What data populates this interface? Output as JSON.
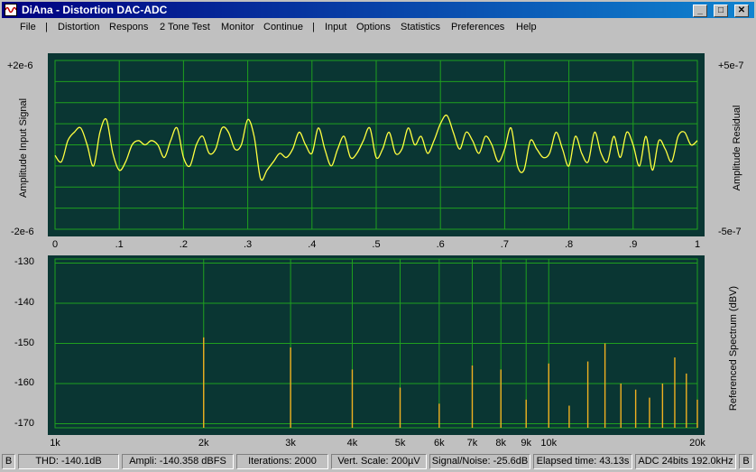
{
  "window": {
    "title": "DiAna - Distortion DAC-ADC",
    "controls": {
      "minimize": "_",
      "maximize": "□",
      "close": "✕"
    },
    "icon": "waveform-icon"
  },
  "menu": {
    "file": "File",
    "sep1": "|",
    "distortion": "Distortion",
    "respons": "Respons",
    "two_tone": "2 Tone Test",
    "monitor": "Monitor",
    "continue": "Continue",
    "sep2": "|",
    "input": "Input",
    "options": "Options",
    "statistics": "Statistics",
    "preferences": "Preferences",
    "help": "Help"
  },
  "colors": {
    "plot_bg": "#0a3633",
    "grid": "#1fa01f",
    "trace": "#ffff40",
    "spectrum_line": "#f0b020"
  },
  "chart_data": [
    {
      "type": "line",
      "ylabel_left": "Amplitude Input Signal",
      "ylabel_right": "Amplitude Residual",
      "left_top": "+2e-6",
      "left_bottom": "-2e-6",
      "right_top": "+5e-7",
      "right_bottom": "-5e-7",
      "x_ticks": [
        "0",
        ".1",
        ".2",
        ".3",
        ".4",
        ".5",
        ".6",
        ".7",
        ".8",
        ".9",
        "1"
      ],
      "xlim": [
        0,
        1
      ],
      "ylim": [
        -2e-06,
        2e-06
      ],
      "grid": true,
      "x": [
        0,
        0.01,
        0.02,
        0.03,
        0.04,
        0.05,
        0.06,
        0.07,
        0.08,
        0.09,
        0.1,
        0.11,
        0.12,
        0.13,
        0.14,
        0.15,
        0.16,
        0.17,
        0.18,
        0.19,
        0.2,
        0.21,
        0.22,
        0.23,
        0.24,
        0.25,
        0.26,
        0.27,
        0.28,
        0.29,
        0.3,
        0.31,
        0.32,
        0.33,
        0.34,
        0.35,
        0.36,
        0.37,
        0.38,
        0.39,
        0.4,
        0.41,
        0.42,
        0.43,
        0.44,
        0.45,
        0.46,
        0.47,
        0.48,
        0.49,
        0.5,
        0.51,
        0.52,
        0.53,
        0.54,
        0.55,
        0.56,
        0.57,
        0.58,
        0.59,
        0.6,
        0.61,
        0.62,
        0.63,
        0.64,
        0.65,
        0.66,
        0.67,
        0.68,
        0.69,
        0.7,
        0.71,
        0.72,
        0.73,
        0.74,
        0.75,
        0.76,
        0.77,
        0.78,
        0.79,
        0.8,
        0.81,
        0.82,
        0.83,
        0.84,
        0.85,
        0.86,
        0.87,
        0.88,
        0.89,
        0.9,
        0.91,
        0.92,
        0.93,
        0.94,
        0.95,
        0.96,
        0.97,
        0.98,
        0.99,
        1
      ],
      "y": [
        -2.5e-07,
        -4e-07,
        1e-07,
        3e-07,
        4e-07,
        0,
        -5e-07,
        3e-07,
        6e-07,
        -2e-07,
        -6e-07,
        -4e-07,
        0,
        1e-07,
        0,
        1e-07,
        0,
        -3e-07,
        1e-07,
        4e-07,
        -3e-07,
        -5e-07,
        0,
        2e-07,
        -2e-07,
        -1e-07,
        4e-07,
        3e-07,
        -1e-07,
        0,
        6e-07,
        2e-07,
        -8e-07,
        -6e-07,
        -4e-07,
        -2e-07,
        -3e-07,
        -1e-07,
        3e-07,
        0,
        -2e-07,
        4e-07,
        -1e-07,
        -5e-07,
        -1e-07,
        2e-07,
        -3e-07,
        -2e-07,
        1e-07,
        4e-07,
        -3e-07,
        -1e-07,
        3e-07,
        -2e-07,
        -1e-07,
        4e-07,
        0,
        2e-07,
        -2e-07,
        1e-07,
        5e-07,
        7e-07,
        3e-07,
        -1e-07,
        3e-07,
        1e-07,
        -2e-07,
        2e-07,
        0,
        -4e-07,
        -1e-07,
        4e-07,
        -5e-07,
        -6e-07,
        1e-07,
        -1e-07,
        -3e-07,
        -2e-07,
        3e-07,
        -1e-07,
        -5e-07,
        2e-07,
        -2e-07,
        -4e-07,
        3e-07,
        -2e-07,
        -4e-07,
        2e-07,
        -3e-07,
        3e-07,
        0,
        -5e-07,
        2e-07,
        -6e-07,
        1e-07,
        -1e-07,
        -4e-07,
        2e-07,
        3e-07,
        0,
        1e-07
      ]
    },
    {
      "type": "bar",
      "ylabel_right": "Referenced Spectrum (dBV)",
      "y_ticks": [
        "-130",
        "-140",
        "-150",
        "-160",
        "-170"
      ],
      "ylim": [
        -171,
        -129
      ],
      "x_scale": "log",
      "xlim": [
        1000,
        20000
      ],
      "x_ticks": [
        "1k",
        "2k",
        "3k",
        "4k",
        "5k",
        "6k",
        "7k",
        "8k",
        "9k",
        "10k",
        "20k"
      ],
      "grid": true,
      "frequencies": [
        2000,
        3000,
        4000,
        5000,
        6000,
        7000,
        8000,
        9000,
        10000,
        11000,
        12000,
        13000,
        14000,
        15000,
        16000,
        17000,
        18000,
        19000,
        20000
      ],
      "values": [
        -148.5,
        -151,
        -156.5,
        -161,
        -165,
        -155.5,
        -156.5,
        -164,
        -155,
        -165.5,
        -154.5,
        -150,
        -160,
        -161.5,
        -163.5,
        -160,
        -153.5,
        -157.5,
        -164
      ]
    }
  ],
  "status": {
    "left_b": "B",
    "thd": "THD: -140.1dB",
    "ampli": "Ampli: -140.358 dBFS",
    "iterations": "Iterations: 2000",
    "vert_scale": "Vert. Scale: 200µV",
    "signal_noise": "Signal/Noise:  -25.6dB",
    "elapsed": "Elapsed time: 43.13s",
    "adc": "ADC 24bits 192.0kHz",
    "right_b": "B"
  }
}
